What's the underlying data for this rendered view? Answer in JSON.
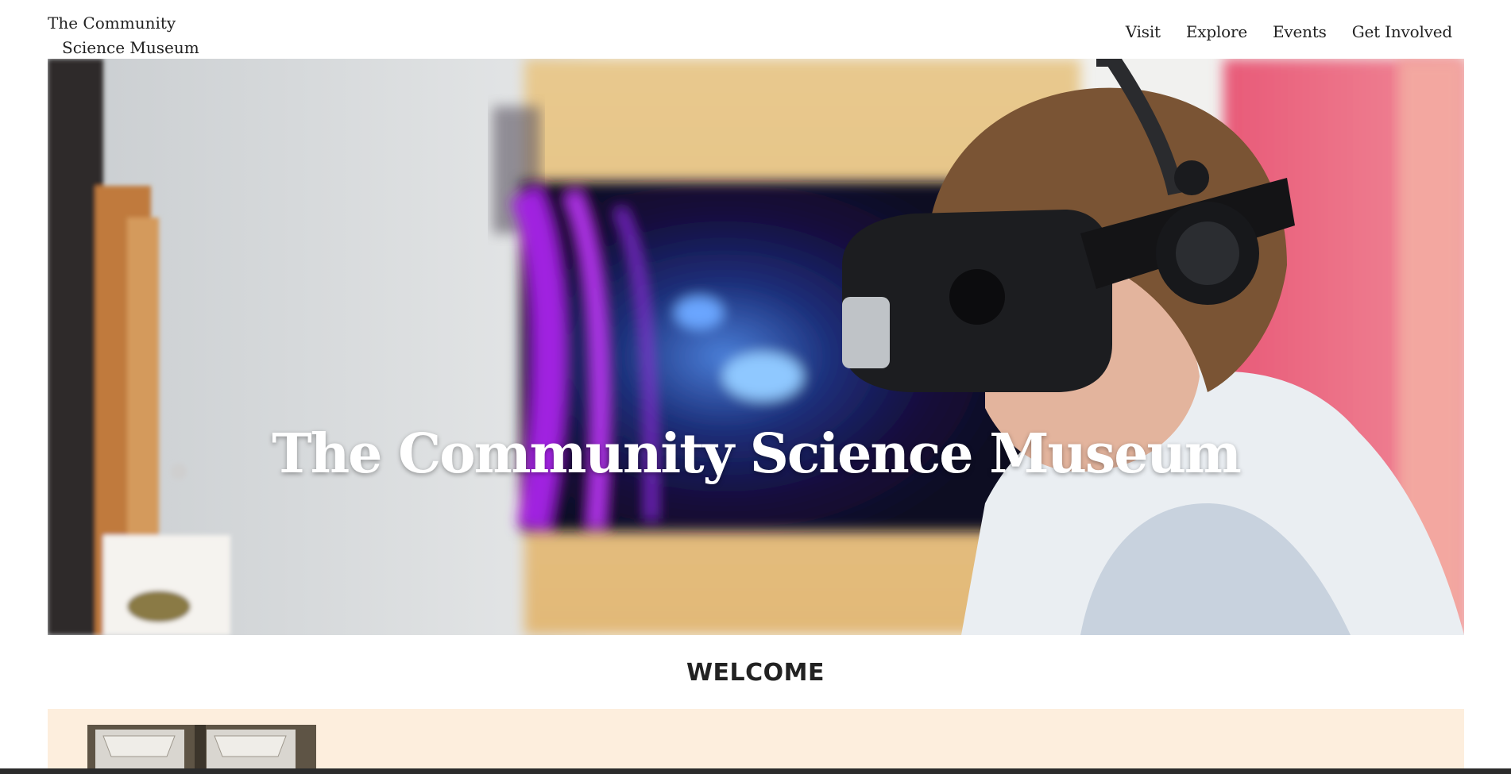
{
  "header": {
    "logo_line1": "The Community",
    "logo_line2": "Science Museum",
    "nav": [
      {
        "label": "Visit"
      },
      {
        "label": "Explore"
      },
      {
        "label": "Events"
      },
      {
        "label": "Get Involved"
      }
    ]
  },
  "hero": {
    "title": "The Community Science Museum"
  },
  "welcome": {
    "heading": "WELCOME"
  },
  "colors": {
    "feature_band": "#fdeedd",
    "text": "#222222"
  }
}
